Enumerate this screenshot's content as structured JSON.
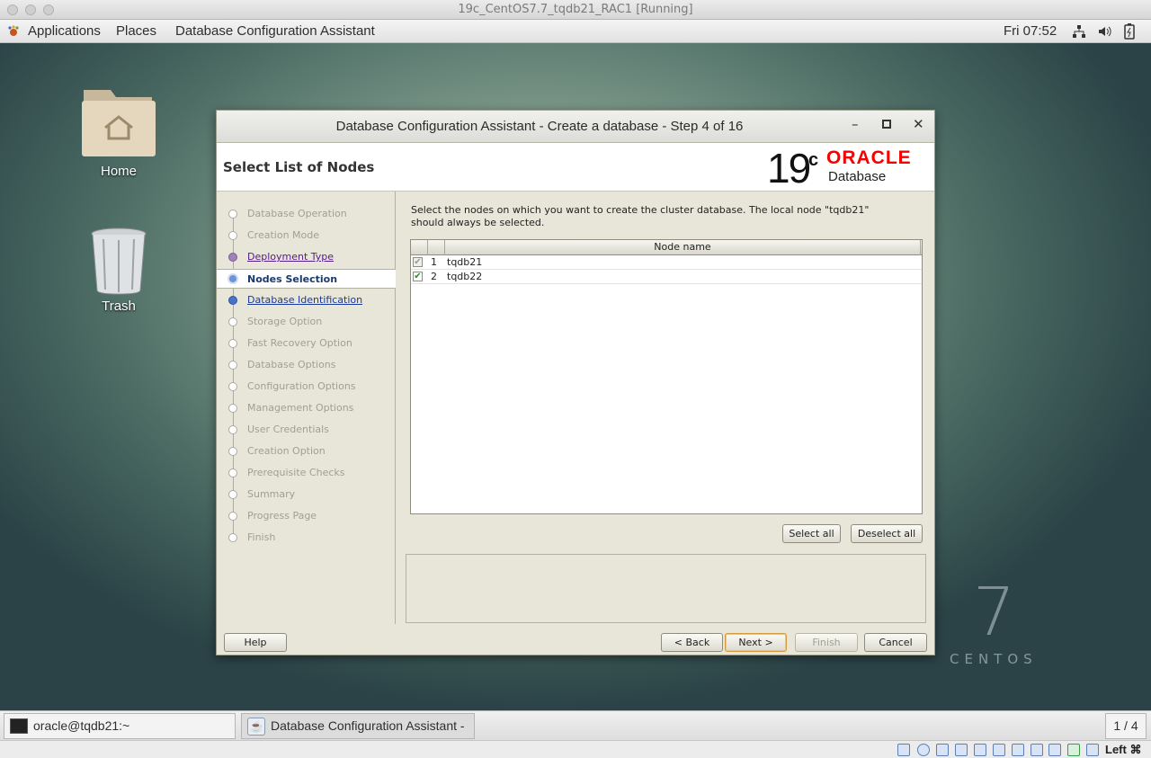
{
  "host": {
    "title": "19c_CentOS7.7_tqdb21_RAC1 [Running]"
  },
  "topbar": {
    "applications": "Applications",
    "places": "Places",
    "app_name": "Database Configuration Assistant",
    "clock": "Fri 07:52"
  },
  "desktop": {
    "icons": [
      {
        "label": "Home"
      },
      {
        "label": "Trash"
      }
    ],
    "watermark_number": "7",
    "watermark_text": "CENTOS"
  },
  "dialog": {
    "title": "Database Configuration Assistant - Create a database - Step 4 of 16",
    "page_title": "Select List of Nodes",
    "logo": {
      "version": "19",
      "version_suffix": "c",
      "brand": "ORACLE",
      "product": "Database"
    },
    "steps": [
      {
        "label": "Database Operation",
        "state": "disabled"
      },
      {
        "label": "Creation Mode",
        "state": "disabled"
      },
      {
        "label": "Deployment Type",
        "state": "done"
      },
      {
        "label": "Nodes Selection",
        "state": "current"
      },
      {
        "label": "Database Identification",
        "state": "next"
      },
      {
        "label": "Storage Option",
        "state": "disabled"
      },
      {
        "label": "Fast Recovery Option",
        "state": "disabled"
      },
      {
        "label": "Database Options",
        "state": "disabled"
      },
      {
        "label": "Configuration Options",
        "state": "disabled"
      },
      {
        "label": "Management Options",
        "state": "disabled"
      },
      {
        "label": "User Credentials",
        "state": "disabled"
      },
      {
        "label": "Creation Option",
        "state": "disabled"
      },
      {
        "label": "Prerequisite Checks",
        "state": "disabled"
      },
      {
        "label": "Summary",
        "state": "disabled"
      },
      {
        "label": "Progress Page",
        "state": "disabled"
      },
      {
        "label": "Finish",
        "state": "disabled"
      }
    ],
    "instruction_line1": "Select the nodes on which you want to create the cluster database. The local node \"tqdb21\"",
    "instruction_line2": "should always be selected.",
    "table": {
      "header": "Node name",
      "rows": [
        {
          "num": "1",
          "name": "tqdb21",
          "checked": true,
          "disabled": true
        },
        {
          "num": "2",
          "name": "tqdb22",
          "checked": true,
          "disabled": false
        }
      ]
    },
    "select_all": "Select all",
    "deselect_all": "Deselect all",
    "buttons": {
      "help": "Help",
      "back": "< Back",
      "next": "Next >",
      "finish": "Finish",
      "cancel": "Cancel"
    }
  },
  "taskbar": {
    "terminal": "oracle@tqdb21:~",
    "dbca": "Database Configuration Assistant - C...",
    "workspace": "1 / 4"
  },
  "statusbar": {
    "host_key": "Left ⌘"
  }
}
